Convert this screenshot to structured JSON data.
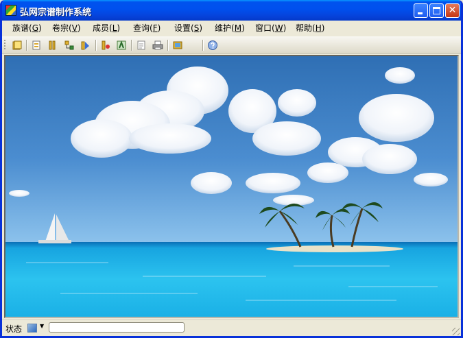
{
  "window": {
    "title": "弘网宗谱制作系统",
    "close_glyph": "✕"
  },
  "menu": [
    {
      "label": "族谱",
      "key": "G"
    },
    {
      "label": "卷宗",
      "key": "V"
    },
    {
      "label": "成员",
      "key": "L"
    },
    {
      "label": "查询",
      "key": "F"
    },
    {
      "label": "设置",
      "key": "S"
    },
    {
      "label": "维护",
      "key": "M"
    },
    {
      "label": "窗口",
      "key": "W"
    },
    {
      "label": "帮助",
      "key": "H"
    }
  ],
  "toolbar": {
    "icons": [
      "open-book-icon",
      "new-volume-icon",
      "volume-list-icon",
      "member-tree-icon",
      "add-member-icon",
      "member-search-icon",
      "tree-view-icon",
      "document-icon",
      "print-icon",
      "image-export-icon",
      "help-icon"
    ]
  },
  "statusbar": {
    "label": "状态",
    "value": ""
  },
  "colors": {
    "titlebar": "#0053ee",
    "window_border": "#0831d9",
    "chrome": "#ece9d8",
    "sky": "#3c7fc3",
    "sea": "#28c0ea"
  }
}
